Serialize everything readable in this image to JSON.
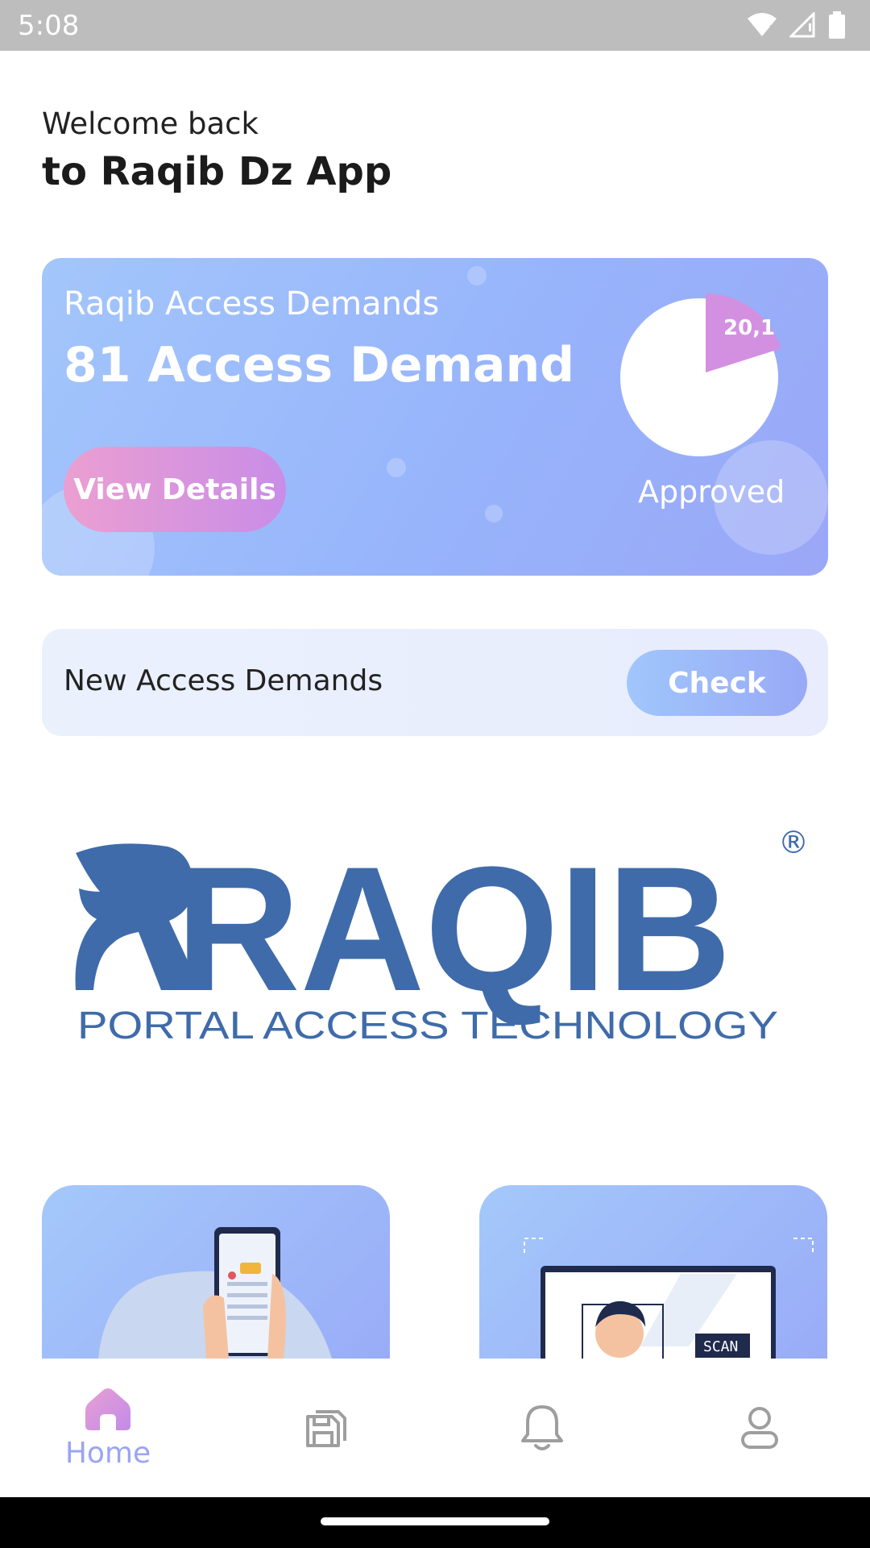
{
  "status_bar": {
    "time": "5:08"
  },
  "greeting": {
    "line1": "Welcome back",
    "line2": "to Raqib Dz App"
  },
  "stats_card": {
    "subtitle": "Raqib Access Demands",
    "title": "81 Access Demand",
    "button_label": "View Details",
    "pie_label": "20,1",
    "pie_caption": "Approved",
    "pie_fraction": 0.201
  },
  "new_demands": {
    "label": "New Access Demands",
    "button_label": "Check"
  },
  "logo": {
    "brand": "RAQIB",
    "tagline": "PORTAL ACCESS TECHNOLOGY",
    "mark": "®"
  },
  "bottom_nav": {
    "items": [
      {
        "icon": "home-icon",
        "label": "Home",
        "active": true
      },
      {
        "icon": "save-icon",
        "label": "",
        "active": false
      },
      {
        "icon": "bell-icon",
        "label": "",
        "active": false
      },
      {
        "icon": "user-icon",
        "label": "",
        "active": false
      }
    ]
  },
  "colors": {
    "accent": "#9aa4f5",
    "pink": "#d390e0",
    "logo_blue": "#3f6baa",
    "icon_gray": "#9e9e9e"
  }
}
